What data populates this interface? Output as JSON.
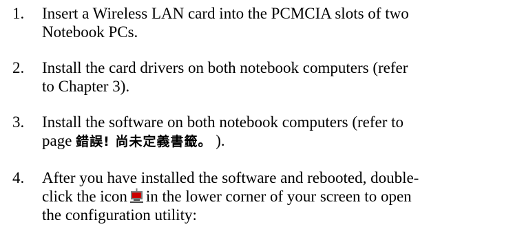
{
  "steps": [
    {
      "number": "1.",
      "lines": [
        "Insert a Wireless LAN card into the PCMCIA slots of two",
        "Notebook PCs."
      ]
    },
    {
      "number": "2.",
      "lines": [
        "Install the card drivers on both notebook computers (refer",
        "to Chapter 3)."
      ]
    },
    {
      "number": "3.",
      "line1": "Install the software on both notebook computers (refer to",
      "line2_before": "page ",
      "line2_error": "錯誤! 尚未定義書籤。",
      "line2_after": " )."
    },
    {
      "number": "4.",
      "line1": "After you have installed the software and rebooted, double-",
      "line2_before": "click the icon",
      "line2_icon": "wireless-monitor-icon",
      "line2_after": "in the lower corner of your screen to open",
      "line3": "the configuration utility:"
    }
  ],
  "colors": {
    "text": "#000000",
    "icon_screen": "#cc0000",
    "icon_body": "#7a7a7a"
  }
}
